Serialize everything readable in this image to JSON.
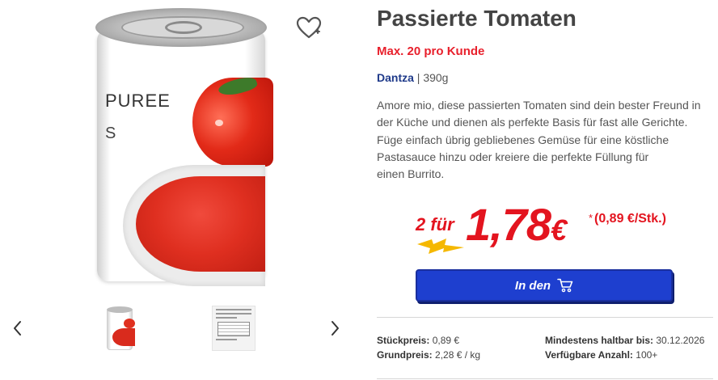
{
  "product": {
    "title": "Passierte Tomaten",
    "limit": "Max. 20 pro Kunde",
    "brand": "Dantza",
    "separator": "|",
    "size": "390g",
    "description_lines": [
      "Amore mio, diese passierten Tomaten sind dein bester Freund in",
      "der Küche und dienen als perfekte Basis für fast alle Gerichte.",
      "Füge einfach übrig gebliebenes Gemüse für eine köstliche",
      "Pastasauce hinzu oder kreiere die perfekte Füllung für",
      "einen Burrito."
    ],
    "can_label_text": "PUREE",
    "can_label_letter": "S"
  },
  "price": {
    "multi_buy": "2 für",
    "amount": "1,78",
    "currency": "€",
    "asterisk": "*",
    "unit_price": "(0,89 €/Stk.)"
  },
  "cart": {
    "button_label": "In den"
  },
  "details": {
    "unit_price_label": "Stückpreis:",
    "unit_price_value": "0,89 €",
    "base_price_label": "Grundpreis:",
    "base_price_value": "2,28 € / kg",
    "best_before_label": "Mindestens haltbar bis:",
    "best_before_value": "30.12.2026",
    "stock_label": "Verfügbare Anzahl:",
    "stock_value": "100+"
  },
  "icons": {
    "wishlist": "heart-outline-icon",
    "prev": "chevron-left-icon",
    "next": "chevron-right-icon",
    "cart": "shopping-cart-icon",
    "bolt": "lightning-bolt-icon"
  },
  "colors": {
    "accent_red": "#e3141f",
    "brand_blue": "#1f3a8a",
    "button_blue": "#1e3fcf",
    "bolt_yellow": "#f5b800"
  }
}
